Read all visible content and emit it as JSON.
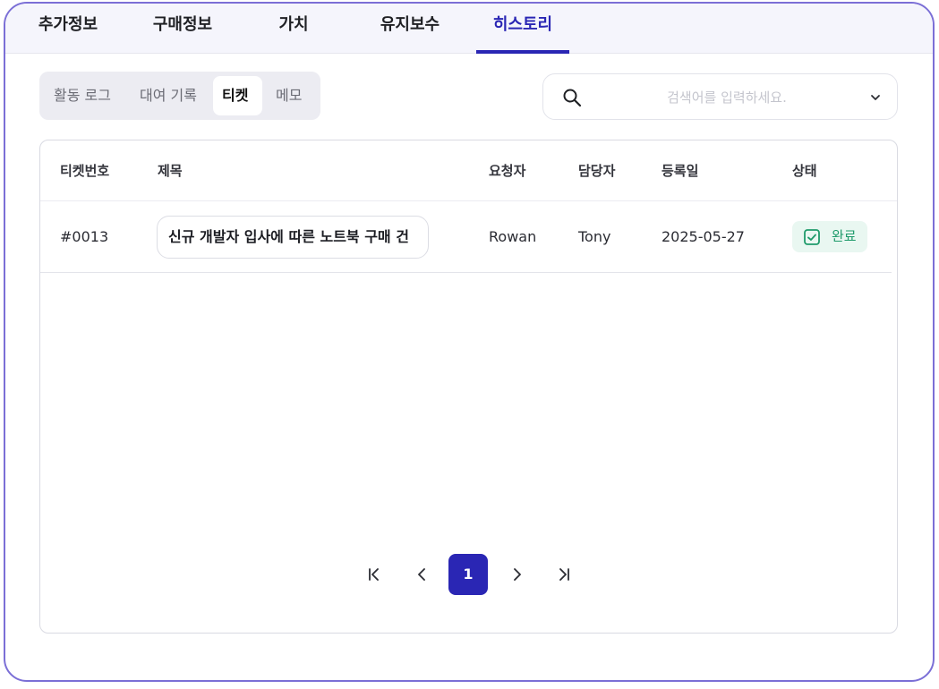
{
  "top_tabs": [
    {
      "label": "추가정보",
      "active": false
    },
    {
      "label": "구매정보",
      "active": false
    },
    {
      "label": "가치",
      "active": false
    },
    {
      "label": "유지보수",
      "active": false
    },
    {
      "label": "히스토리",
      "active": true
    }
  ],
  "sub_tabs": [
    {
      "label": "활동 로그",
      "active": false
    },
    {
      "label": "대여 기록",
      "active": false
    },
    {
      "label": "티켓",
      "active": true
    },
    {
      "label": "메모",
      "active": false
    }
  ],
  "search": {
    "placeholder": "검색어를 입력하세요.",
    "value": "",
    "icon": "search-icon",
    "dropdown_icon": "chevron-down-icon"
  },
  "table": {
    "columns": [
      "티켓번호",
      "제목",
      "요청자",
      "담당자",
      "등록일",
      "상태"
    ],
    "rows": [
      {
        "ticket_no": "#0013",
        "title": "신규 개발자 입사에 따른 노트북 구매 건",
        "requester": "Rowan",
        "assignee": "Tony",
        "date": "2025-05-27",
        "status": "완료"
      }
    ]
  },
  "pagination": {
    "current_page": "1",
    "icons": [
      "first-page-icon",
      "prev-page-icon",
      "next-page-icon",
      "last-page-icon"
    ]
  },
  "colors": {
    "accent": "#2a26b4",
    "frame": "#7b6fd6",
    "status_done_bg": "#e9f7f1",
    "status_done_text": "#1f9b6b"
  }
}
